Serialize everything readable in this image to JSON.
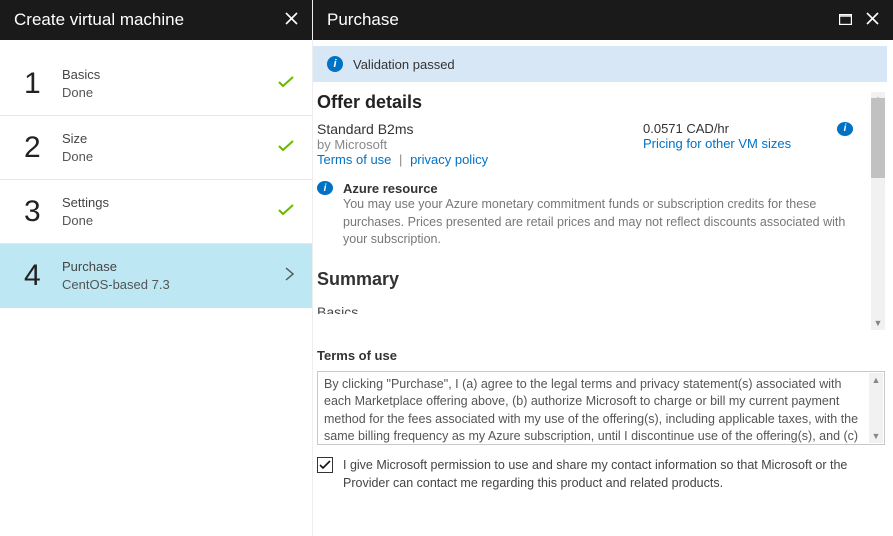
{
  "left": {
    "title": "Create virtual machine",
    "steps": [
      {
        "num": "1",
        "title": "Basics",
        "sub": "Done",
        "done": true
      },
      {
        "num": "2",
        "title": "Size",
        "sub": "Done",
        "done": true
      },
      {
        "num": "3",
        "title": "Settings",
        "sub": "Done",
        "done": true
      },
      {
        "num": "4",
        "title": "Purchase",
        "sub": "CentOS-based 7.3",
        "active": true
      }
    ]
  },
  "right": {
    "title": "Purchase",
    "validation": "Validation passed",
    "offer": {
      "heading": "Offer details",
      "name": "Standard B2ms",
      "by_label": "by Microsoft",
      "terms_link": "Terms of use",
      "privacy_link": "privacy policy",
      "price": "0.0571 CAD/hr",
      "pricing_link": "Pricing for other VM sizes"
    },
    "azure_note": {
      "title": "Azure resource",
      "body": "You may use your Azure monetary commitment funds or subscription credits for these purchases. Prices presented are retail prices and may not reflect discounts associated with your subscription."
    },
    "summary": {
      "heading": "Summary",
      "cut_label": "Basics"
    },
    "terms": {
      "heading": "Terms of use",
      "body": "By clicking \"Purchase\", I (a) agree to the legal terms and privacy statement(s) associated with each Marketplace offering above, (b) authorize Microsoft to charge or bill my current payment method for the fees associated with my use of the offering(s), including applicable taxes, with the same billing frequency as my Azure subscription, until I discontinue use of the offering(s), and (c)"
    },
    "consent": {
      "checked": true,
      "text": "I give Microsoft permission to use and share my contact information so that Microsoft or the Provider can contact me regarding this product and related products."
    }
  }
}
